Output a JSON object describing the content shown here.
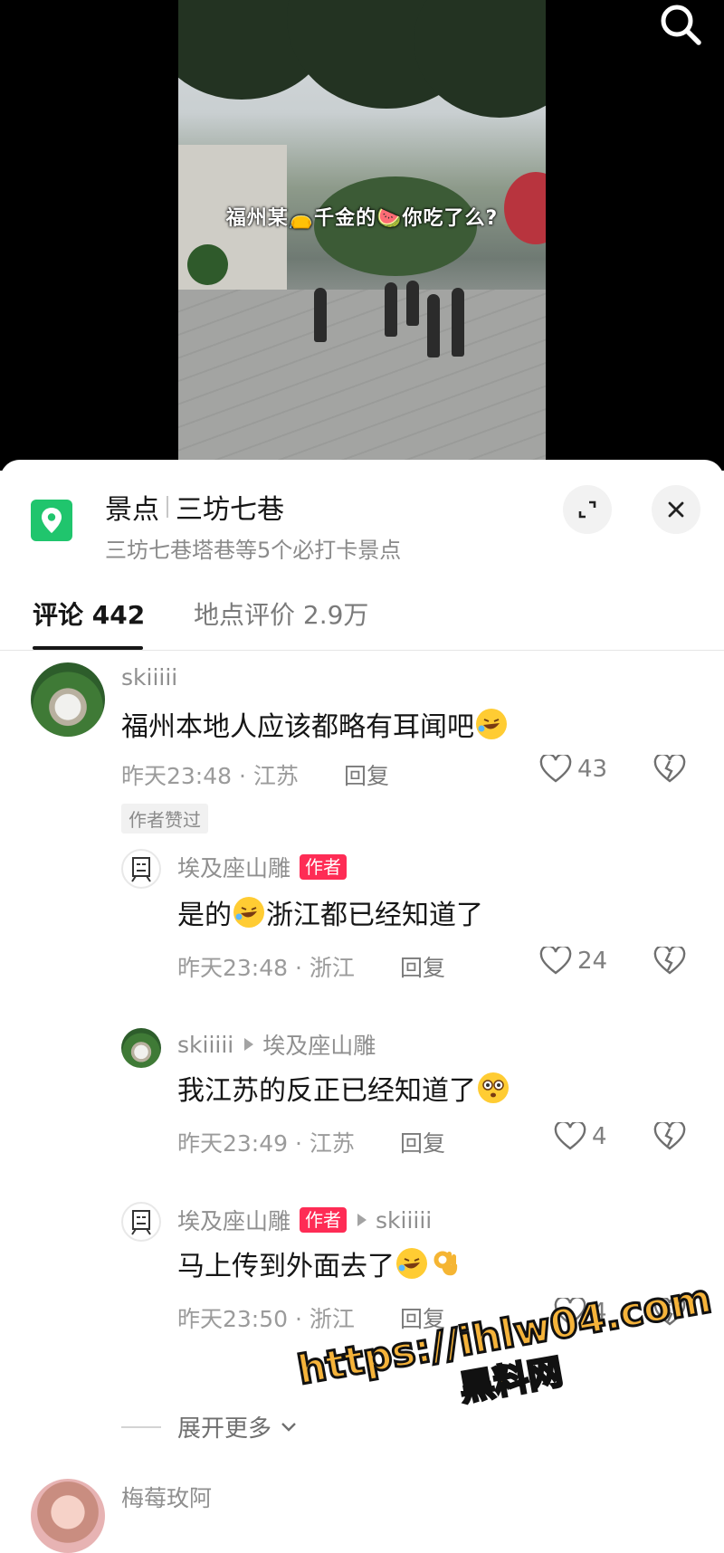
{
  "video": {
    "caption": "福州某👝千金的🍉你吃了么?",
    "search_icon": "search-icon"
  },
  "location": {
    "category": "景点",
    "name": "三坊七巷",
    "subtitle": "三坊七巷塔巷等5个必打卡景点",
    "icon": "map-pin-icon",
    "icon_color": "#20c56d"
  },
  "tabs": [
    {
      "label": "评论 442",
      "active": true
    },
    {
      "label": "地点评价 2.9万",
      "active": false
    }
  ],
  "comments": [
    {
      "user": "skiiiii",
      "text": "福州本地人应该都略有耳闻吧",
      "emoji": "rofl-emoji",
      "time_location": "昨天23:48 · 江苏",
      "reply_label": "回复",
      "likes": "43",
      "badge": "作者赞过"
    },
    {
      "user": "埃及座山雕",
      "is_author": "作者",
      "text_before": "是的",
      "emoji": "rofl-emoji",
      "text_after": "浙江都已经知道了",
      "time_location": "昨天23:48 · 浙江",
      "reply_label": "回复",
      "likes": "24"
    },
    {
      "user": "skiiiii",
      "reply_to": "埃及座山雕",
      "text": "我江苏的反正已经知道了",
      "emoji": "flushed-emoji",
      "time_location": "昨天23:49 · 江苏",
      "reply_label": "回复",
      "likes": "4"
    },
    {
      "user": "埃及座山雕",
      "is_author": "作者",
      "reply_to": "skiiiii",
      "text": "马上传到外面去了",
      "emoji": "rofl-emoji",
      "emoji2": "ok-hand-emoji",
      "time_location": "昨天23:50 · 浙江",
      "reply_label": "回复",
      "likes": "4"
    }
  ],
  "expand_more": "展开更多",
  "next_comment_user": "梅莓玫阿",
  "watermark": {
    "line1": "https://ihlw04.com",
    "line2": "黑料网"
  },
  "colors": {
    "author_badge": "#fe2c55",
    "accent_green": "#20c56d"
  }
}
